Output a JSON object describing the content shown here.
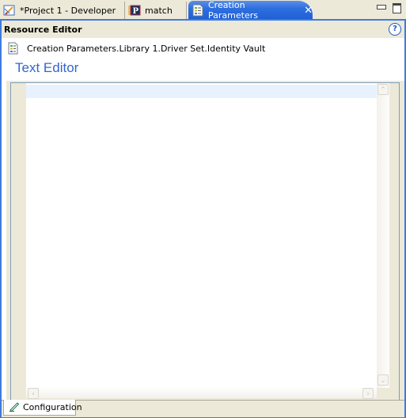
{
  "tabs": [
    {
      "label": "*Project 1 - Developer",
      "icon": "project-edit-icon",
      "active": false
    },
    {
      "label": "match",
      "icon": "policy-p-icon",
      "active": false
    },
    {
      "label": "Creation Parameters",
      "icon": "resource-doc-icon",
      "active": true,
      "close_glyph": "✕"
    }
  ],
  "window_controls": {
    "minimize": "minimize-icon",
    "maximize": "maximize-icon"
  },
  "header": {
    "title": "Resource Editor",
    "help_glyph": "?"
  },
  "resource_path": "Creation Parameters.Library 1.Driver Set.Identity Vault",
  "section_title": "Text Editor",
  "editor": {
    "content": "",
    "scroll_up": "⌃",
    "scroll_down": "⌄",
    "scroll_left": "‹",
    "scroll_right": "›"
  },
  "bottom_tabs": [
    {
      "label": "Configuration",
      "icon": "pencil-icon",
      "active": true
    }
  ],
  "colors": {
    "frame_blue": "#3D7BE0",
    "title_blue": "#3366CC",
    "current_line": "#E8F2FE",
    "chrome": "#ECE9D8"
  }
}
